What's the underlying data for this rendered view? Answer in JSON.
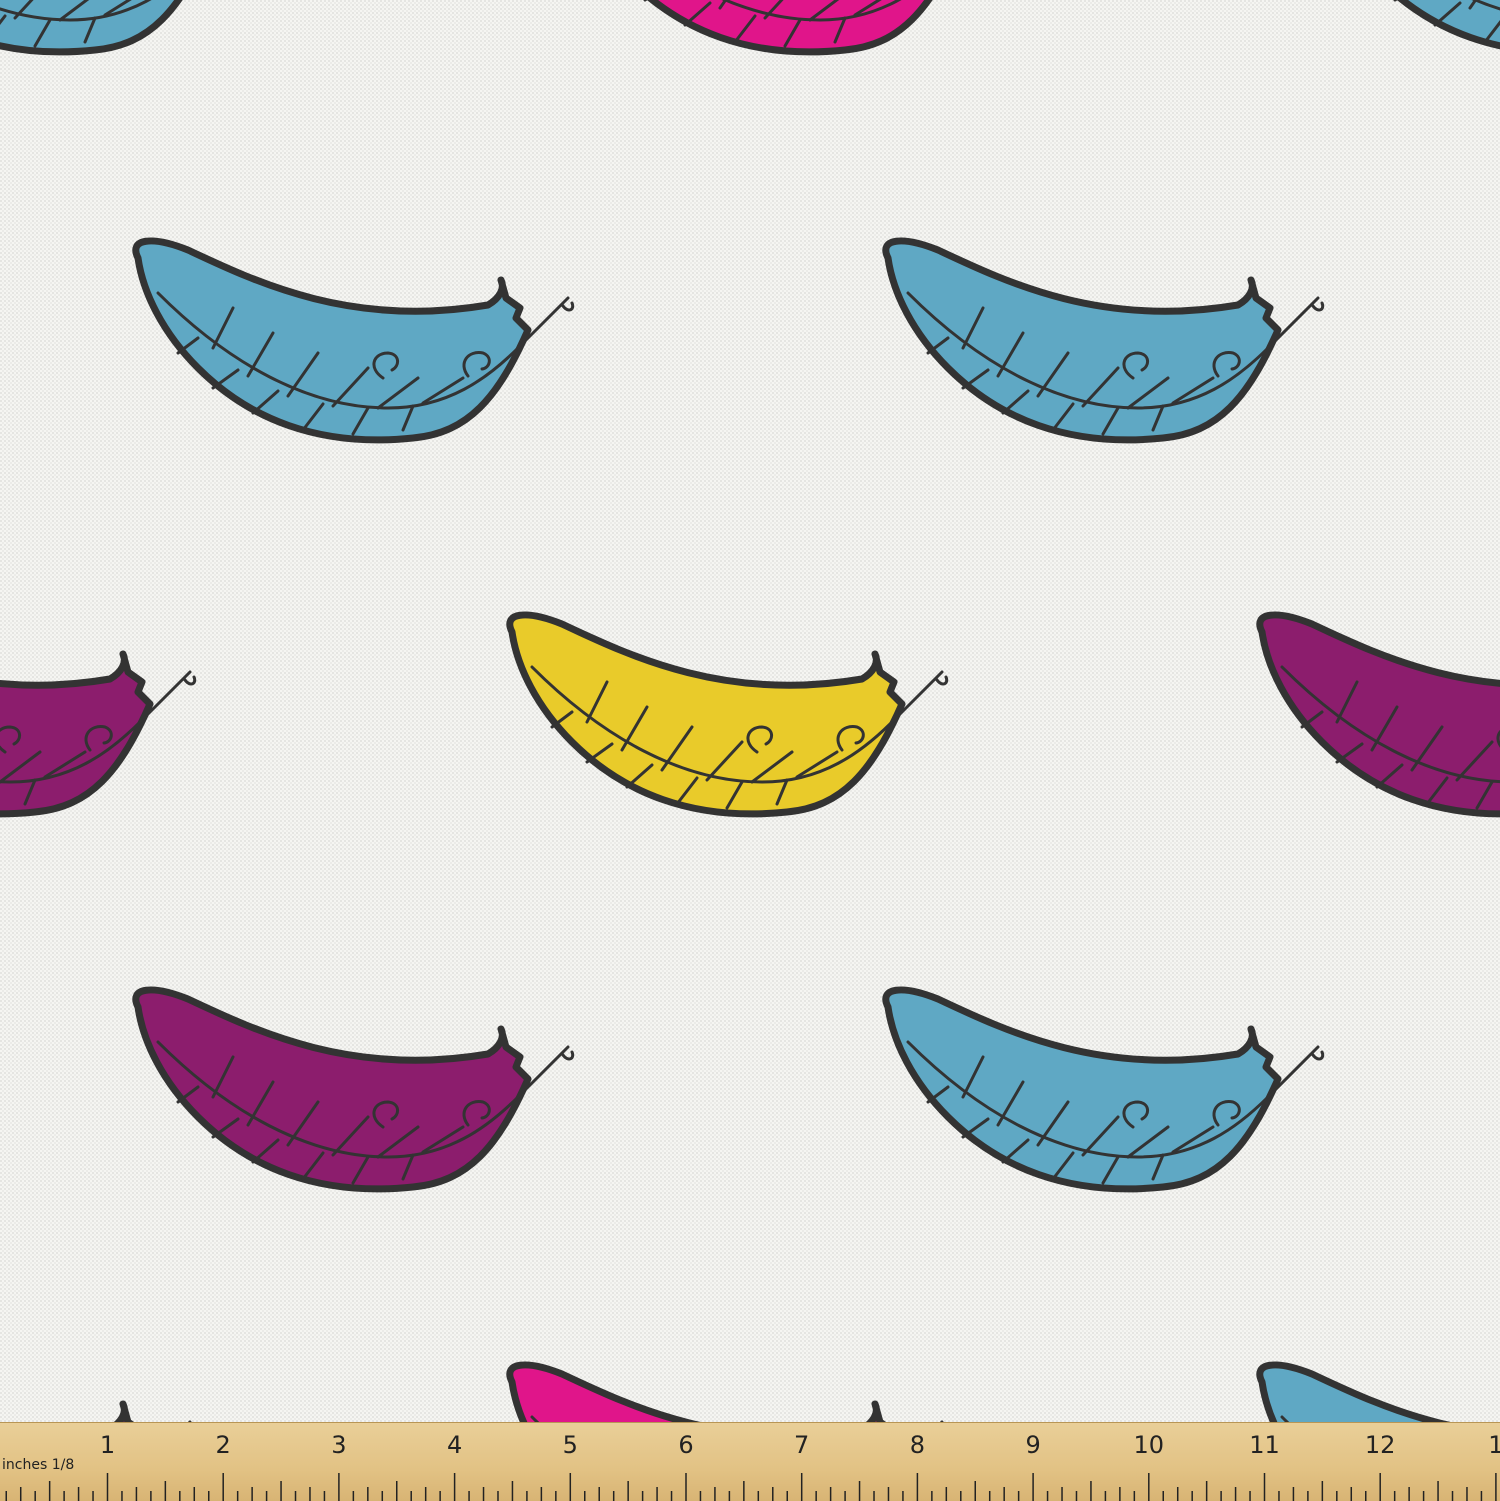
{
  "colors": {
    "background": "#f5f5f2",
    "outline": "#333333",
    "feather_blue": "#5fa8c4",
    "feather_pink": "#e0158a",
    "feather_purple": "#8c1d6d",
    "feather_yellow": "#e9cb2a",
    "ruler": "#e2c284"
  },
  "ruler": {
    "unit_label": "inches 1/8",
    "numbers": [
      "1",
      "2",
      "3",
      "4",
      "5",
      "6",
      "7",
      "8",
      "9",
      "10",
      "11",
      "12",
      "1"
    ]
  }
}
